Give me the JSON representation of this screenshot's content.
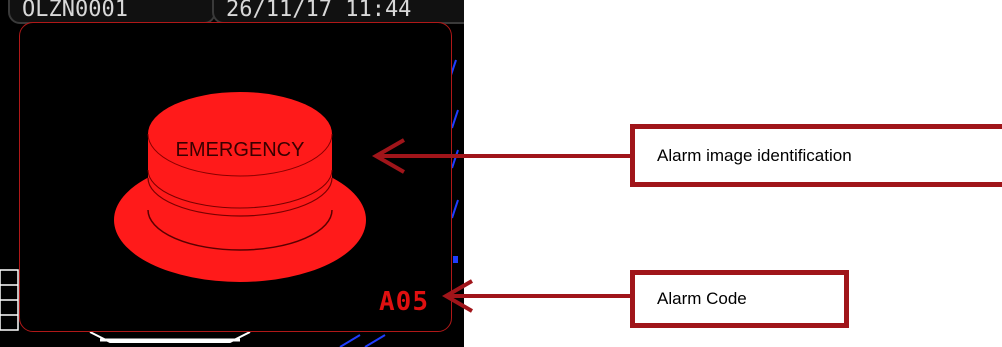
{
  "device": {
    "status_left": "OLZN0001",
    "status_right": "26/11/17 11:44"
  },
  "alarm": {
    "button_label": "EMERGENCY",
    "code": "A05"
  },
  "callouts": {
    "image_identification": "Alarm image identification",
    "alarm_code": "Alarm Code"
  },
  "colors": {
    "alarm_red": "#ff1a1a",
    "code_red": "#e01010",
    "callout_border": "#a0151a",
    "arrow": "#a0151a",
    "device_background": "#000000",
    "accent_blue": "#1f3dff"
  }
}
